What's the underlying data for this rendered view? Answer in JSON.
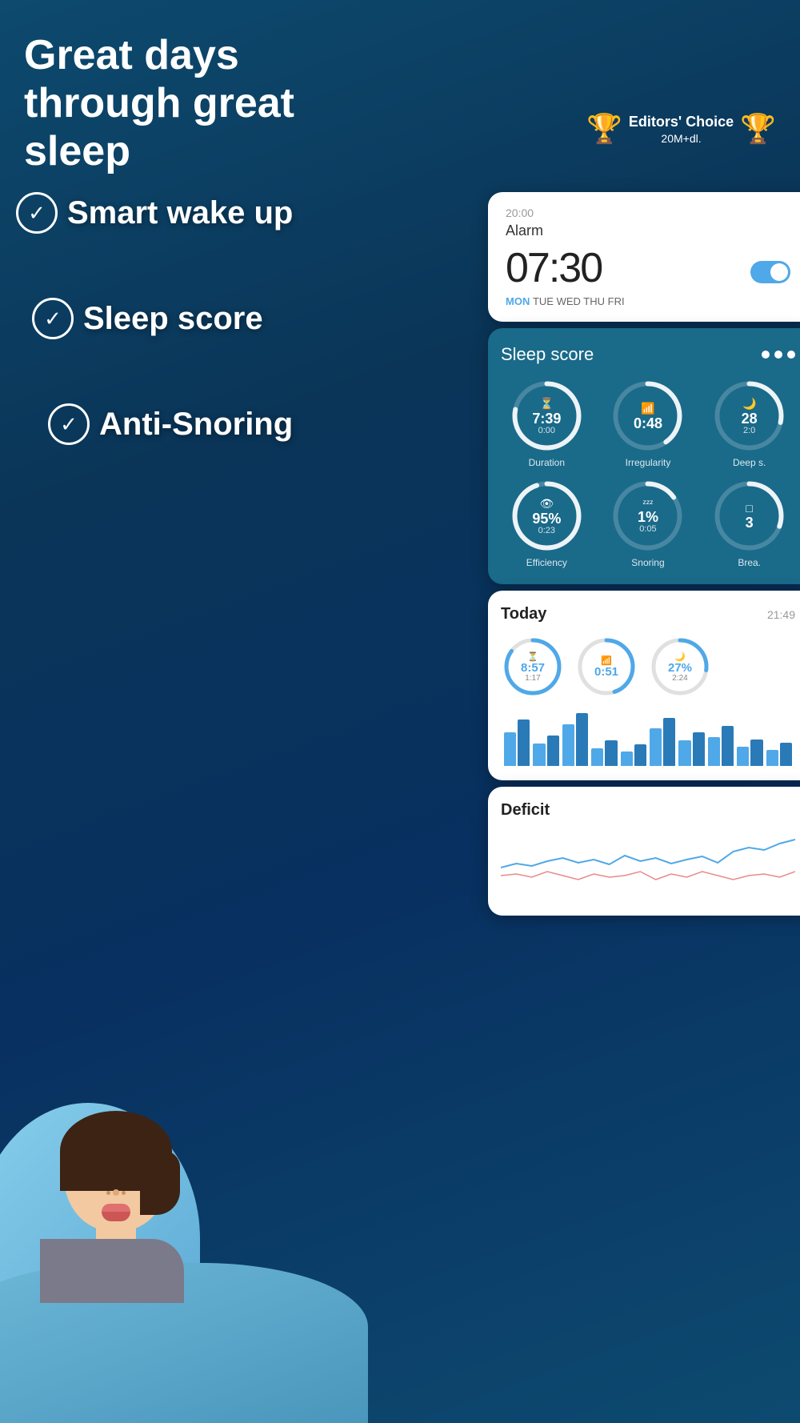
{
  "app": {
    "headline": "Great days through great sleep",
    "badge": {
      "title": "Editors' Choice",
      "subtitle": "20M+dl.",
      "laurel_left": "❧",
      "laurel_right": "❧"
    }
  },
  "features": [
    {
      "id": "smart-wake-up",
      "label": "Smart wake up"
    },
    {
      "id": "sleep-score",
      "label": "Sleep score"
    },
    {
      "id": "anti-snoring",
      "label": "Anti-Snoring"
    }
  ],
  "alarm_card": {
    "time_label": "20:00",
    "title": "Alarm",
    "time": "07:30",
    "days": [
      "MON",
      "TUE",
      "WED",
      "THU",
      "FRI"
    ],
    "active_day": "MON"
  },
  "sleep_score_card": {
    "title": "Sleep score",
    "metrics": [
      {
        "id": "duration",
        "icon": "⏳",
        "main": "7:39",
        "sub": "0:00",
        "label": "Duration",
        "progress": 0.78
      },
      {
        "id": "irregularity",
        "icon": "📊",
        "main": "0:48",
        "sub": "",
        "label": "Irregularity",
        "progress": 0.4
      },
      {
        "id": "deep-sleep",
        "icon": "🌙",
        "main": "28",
        "sub": "2:0",
        "label": "Deep s.",
        "progress": 0.28
      },
      {
        "id": "efficiency",
        "icon": "👁",
        "main": "95%",
        "sub": "0:23",
        "label": "Efficiency",
        "progress": 0.95
      },
      {
        "id": "snoring",
        "icon": "💤",
        "main": "1%",
        "sub": "0:05",
        "label": "Snoring",
        "progress": 0.15
      },
      {
        "id": "breathing",
        "icon": "□",
        "main": "3",
        "sub": "",
        "label": "Brea.",
        "progress": 0.3
      }
    ]
  },
  "today_card": {
    "title": "Today",
    "time": "21:49",
    "metrics": [
      {
        "id": "duration",
        "icon": "⏳",
        "main": "8:57",
        "sub": "1:17",
        "progress": 0.85
      },
      {
        "id": "irregularity",
        "icon": "📊",
        "main": "0:51",
        "sub": "",
        "progress": 0.45
      },
      {
        "id": "deep-sleep",
        "icon": "🌙",
        "main": "27%",
        "sub": "2:24",
        "progress": 0.27
      }
    ],
    "bars": [
      [
        40,
        55
      ],
      [
        25,
        35
      ],
      [
        50,
        65
      ],
      [
        20,
        30
      ],
      [
        15,
        25
      ],
      [
        45,
        60
      ],
      [
        30,
        40
      ],
      [
        35,
        48
      ],
      [
        22,
        32
      ],
      [
        18,
        28
      ]
    ]
  },
  "deficit_card": {
    "title": "Deficit"
  },
  "colors": {
    "bg_dark": "#0a3558",
    "bg_medium": "#1a6a8a",
    "accent_blue": "#4fa8e8",
    "white": "#ffffff",
    "text_dark": "#222222",
    "text_gray": "#999999"
  }
}
